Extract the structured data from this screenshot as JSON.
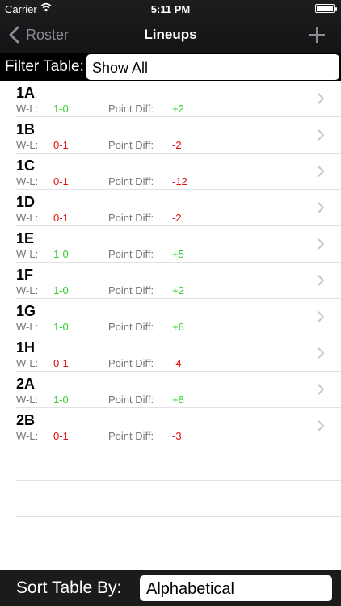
{
  "status": {
    "carrier": "Carrier",
    "time": "5:11 PM"
  },
  "nav": {
    "back_label": "Roster",
    "title": "Lineups"
  },
  "filter": {
    "label": "Filter Table:",
    "value": "Show All"
  },
  "labels": {
    "wl": "W-L:",
    "pd": "Point Diff:"
  },
  "lineups": [
    {
      "name": "1A",
      "wl": "1-0",
      "wl_status": "pos",
      "pd": "+2",
      "pd_status": "pos"
    },
    {
      "name": "1B",
      "wl": "0-1",
      "wl_status": "neg",
      "pd": "-2",
      "pd_status": "neg"
    },
    {
      "name": "1C",
      "wl": "0-1",
      "wl_status": "neg",
      "pd": "-12",
      "pd_status": "neg"
    },
    {
      "name": "1D",
      "wl": "0-1",
      "wl_status": "neg",
      "pd": "-2",
      "pd_status": "neg"
    },
    {
      "name": "1E",
      "wl": "1-0",
      "wl_status": "pos",
      "pd": "+5",
      "pd_status": "pos"
    },
    {
      "name": "1F",
      "wl": "1-0",
      "wl_status": "pos",
      "pd": "+2",
      "pd_status": "pos"
    },
    {
      "name": "1G",
      "wl": "1-0",
      "wl_status": "pos",
      "pd": "+6",
      "pd_status": "pos"
    },
    {
      "name": "1H",
      "wl": "0-1",
      "wl_status": "neg",
      "pd": "-4",
      "pd_status": "neg"
    },
    {
      "name": "2A",
      "wl": "1-0",
      "wl_status": "pos",
      "pd": "+8",
      "pd_status": "pos"
    },
    {
      "name": "2B",
      "wl": "0-1",
      "wl_status": "neg",
      "pd": "-3",
      "pd_status": "neg"
    }
  ],
  "sort": {
    "label": "Sort Table By:",
    "value": "Alphabetical"
  },
  "colors": {
    "positive": "#2fcf2f",
    "negative": "#e01010",
    "bar": "#1b1b1c"
  },
  "icons": {
    "back": "chevron-left-icon",
    "add": "plus-icon",
    "row": "chevron-right-icon"
  }
}
